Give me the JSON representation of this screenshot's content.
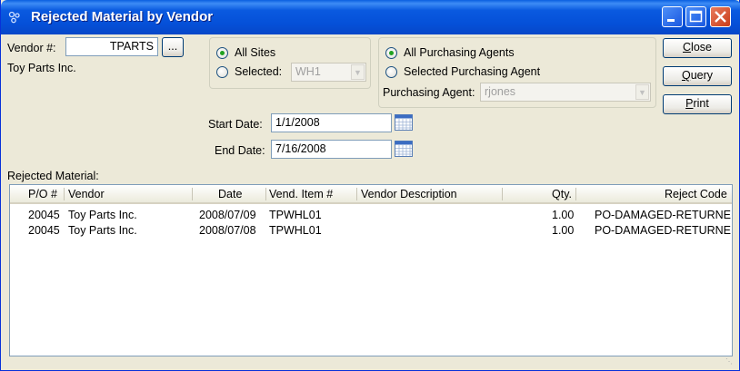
{
  "window": {
    "title": "Rejected Material by Vendor"
  },
  "vendor": {
    "label": "Vendor #:",
    "value": "TPARTS",
    "lookup_label": "...",
    "name": "Toy Parts Inc."
  },
  "sites": {
    "all_label": "All Sites",
    "selected_label": "Selected:",
    "selected_value": "WH1",
    "mode": "all"
  },
  "agents": {
    "all_label": "All Purchasing Agents",
    "selected_label": "Selected Purchasing Agent",
    "agent_label": "Purchasing Agent:",
    "agent_value": "rjones",
    "mode": "all"
  },
  "buttons": {
    "close_u": "C",
    "close_rest": "lose",
    "query_u": "Q",
    "query_rest": "uery",
    "print_u": "P",
    "print_rest": "rint"
  },
  "dates": {
    "start_label": "Start Date:",
    "start_value": "1/1/2008",
    "end_label": "End Date:",
    "end_value": "7/16/2008"
  },
  "table": {
    "caption": "Rejected Material:",
    "columns": [
      "P/O #",
      "Vendor",
      "Date",
      "Vend. Item #",
      "Vendor Description",
      "Qty.",
      "Reject Code"
    ],
    "rows": [
      {
        "po": "20045",
        "vendor": "Toy Parts Inc.",
        "date": "2008/07/09",
        "item": "TPWHL01",
        "desc": "",
        "qty": "1.00",
        "code": "PO-DAMAGED-RETURNED"
      },
      {
        "po": "20045",
        "vendor": "Toy Parts Inc.",
        "date": "2008/07/08",
        "item": "TPWHL01",
        "desc": "",
        "qty": "1.00",
        "code": "PO-DAMAGED-RETURNED"
      }
    ]
  },
  "colors": {
    "titlebar": "#0a5ae0",
    "accent_radio": "#21a121",
    "window_bg": "#ece9d8"
  }
}
